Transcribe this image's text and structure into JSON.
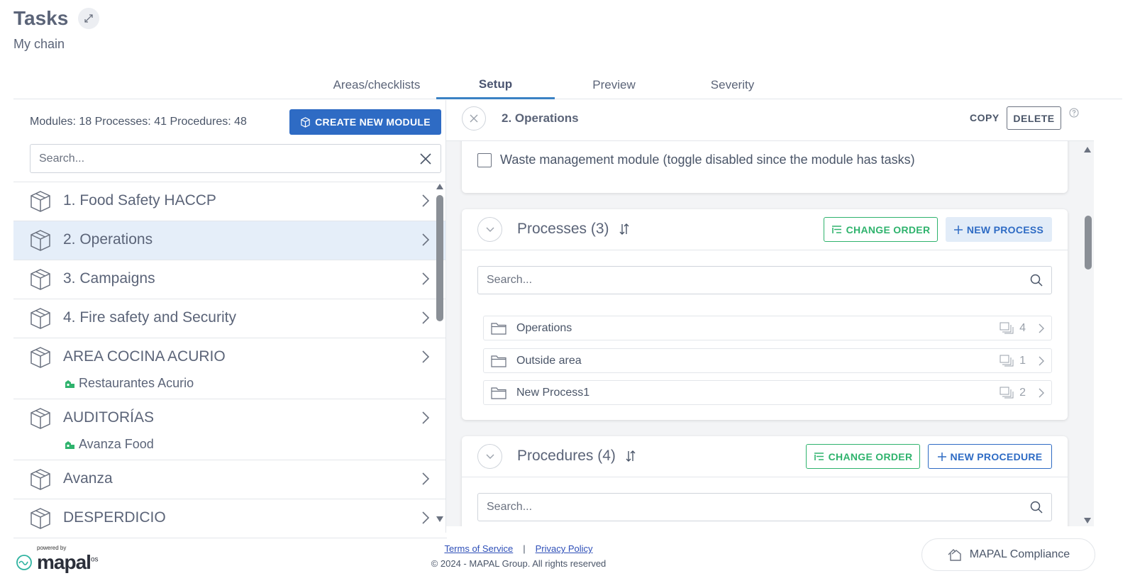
{
  "header": {
    "title": "Tasks",
    "subtitle": "My chain"
  },
  "tabs": [
    {
      "label": "Areas/checklists",
      "active": false
    },
    {
      "label": "Setup",
      "active": true
    },
    {
      "label": "Preview",
      "active": false
    },
    {
      "label": "Severity",
      "active": false
    }
  ],
  "left": {
    "counts": "Modules: 18 Processes: 41 Procedures: 48",
    "create_label": "CREATE NEW MODULE",
    "search_placeholder": "Search...",
    "modules": [
      {
        "name": "1. Food Safety HACCP"
      },
      {
        "name": "2. Operations"
      },
      {
        "name": "3. Campaigns"
      },
      {
        "name": "4. Fire safety and Security"
      },
      {
        "name": "AREA COCINA ACURIO",
        "org": "Restaurantes Acurio"
      },
      {
        "name": "AUDITORÍAS",
        "org": "Avanza Food"
      },
      {
        "name": "Avanza"
      },
      {
        "name": "DESPERDICIO"
      }
    ]
  },
  "right": {
    "title": "2. Operations",
    "copy_label": "COPY",
    "delete_label": "DELETE",
    "waste_label": "Waste management module (toggle disabled since the module has tasks)",
    "processes": {
      "title": "Processes (3)",
      "change_order_label": "CHANGE ORDER",
      "new_label": "NEW PROCESS",
      "search_placeholder": "Search...",
      "items": [
        {
          "name": "Operations",
          "count": "4"
        },
        {
          "name": "Outside area",
          "count": "1"
        },
        {
          "name": "New Process1",
          "count": "2"
        }
      ]
    },
    "procedures": {
      "title": "Procedures (4)",
      "change_order_label": "CHANGE ORDER",
      "new_label": "NEW PROCEDURE",
      "search_placeholder": "Search..."
    }
  },
  "footer": {
    "powered_by": "powered by",
    "logo_text": "mapal",
    "logo_sup": "os",
    "terms": "Terms of Service",
    "separator": "|",
    "privacy": "Privacy Policy",
    "copyright": "© 2024 - MAPAL Group. All rights reserved",
    "compliance_label": "MAPAL Compliance"
  },
  "colors": {
    "primary": "#2e6bc4",
    "green": "#2fb36d",
    "selected_bg": "#e5eef9"
  }
}
